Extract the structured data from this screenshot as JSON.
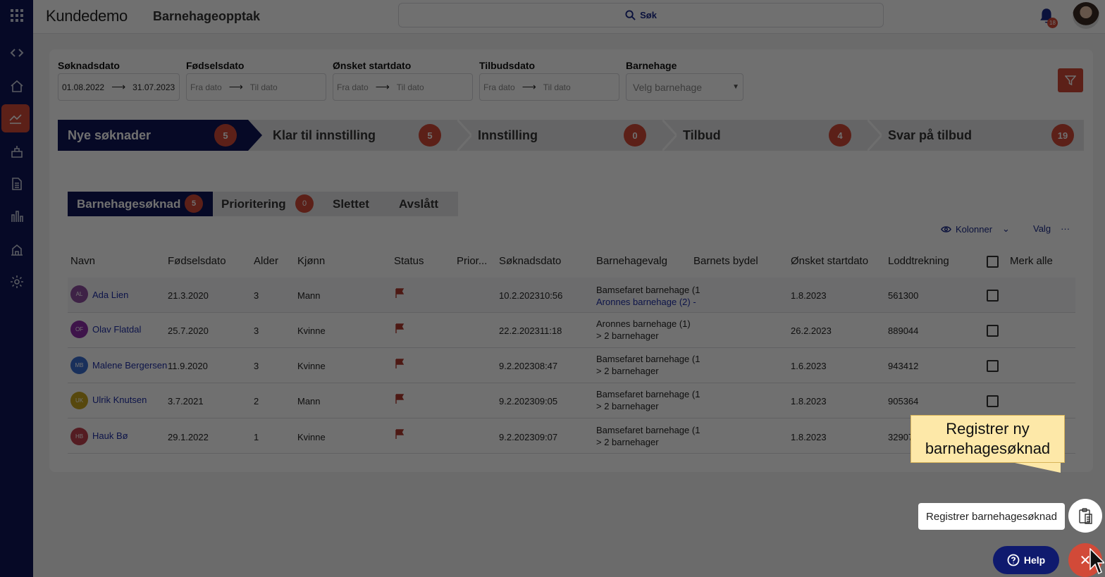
{
  "app": {
    "brand": "Kundedemo",
    "module": "Barnehageopptak"
  },
  "search": {
    "label": "Søk"
  },
  "notifications": {
    "count": "18"
  },
  "filters": [
    {
      "label": "Søknadsdato",
      "from": "01.08.2022",
      "to": "31.07.2023"
    },
    {
      "label": "Fødselsdato",
      "from": "Fra dato",
      "to": "Til dato"
    },
    {
      "label": "Ønsket startdato",
      "from": "Fra dato",
      "to": "Til dato"
    },
    {
      "label": "Tilbudsdato",
      "from": "Fra dato",
      "to": "Til dato"
    },
    {
      "label": "Barnehage",
      "placeholder": "Velg barnehage"
    }
  ],
  "steps": [
    {
      "label": "Nye søknader",
      "count": "5"
    },
    {
      "label": "Klar til innstilling",
      "count": "5"
    },
    {
      "label": "Innstilling",
      "count": "0"
    },
    {
      "label": "Tilbud",
      "count": "4"
    },
    {
      "label": "Svar på tilbud",
      "count": "19"
    }
  ],
  "subtabs": [
    {
      "label": "Barnehagesøknad",
      "count": "5"
    },
    {
      "label": "Prioritering",
      "count": "0"
    },
    {
      "label": "Slettet"
    },
    {
      "label": "Avslått"
    }
  ],
  "tools": {
    "columns": "Kolonner",
    "options": "Valg"
  },
  "columns": [
    "Navn",
    "Fødselsdato",
    "Alder",
    "Kjønn",
    "Status",
    "Prior...",
    "Søknadsdato",
    "Barnehagevalg",
    "Barnets bydel",
    "Ønsket startdato",
    "Loddtrekning",
    "Merk alle"
  ],
  "rows": [
    {
      "initials": "AL",
      "color": "#8e4fa0",
      "name": "Ada Lien",
      "dob": "21.3.2020",
      "age": "3",
      "gender": "Mann",
      "applied": "10.2.202310:56",
      "choice1": "Bamsefaret barnehage (1",
      "choice2": "Aronnes barnehage (2) -",
      "start": "1.8.2023",
      "lottery": "561300"
    },
    {
      "initials": "OF",
      "color": "#8e2fa8",
      "name": "Olav Flatdal",
      "dob": "25.7.2020",
      "age": "3",
      "gender": "Kvinne",
      "applied": "22.2.202311:18",
      "choice1": "Aronnes barnehage (1)",
      "choice2": "2 barnehager",
      "start": "26.2.2023",
      "lottery": "889044"
    },
    {
      "initials": "MB",
      "color": "#3a6fd0",
      "name": "Malene Bergersen",
      "dob": "11.9.2020",
      "age": "3",
      "gender": "Kvinne",
      "applied": "9.2.202308:47",
      "choice1": "Bamsefaret barnehage (1",
      "choice2": "2 barnehager",
      "start": "1.6.2023",
      "lottery": "943412"
    },
    {
      "initials": "UK",
      "color": "#c7a51e",
      "name": "Ulrik Knutsen",
      "dob": "3.7.2021",
      "age": "2",
      "gender": "Mann",
      "applied": "9.2.202309:05",
      "choice1": "Bamsefaret barnehage (1",
      "choice2": "2 barnehager",
      "start": "1.8.2023",
      "lottery": "905364"
    },
    {
      "initials": "HB",
      "color": "#c0404e",
      "name": "Hauk Bø",
      "dob": "29.1.2022",
      "age": "1",
      "gender": "Kvinne",
      "applied": "9.2.202309:07",
      "choice1": "Bamsefaret barnehage (1",
      "choice2": "2 barnehager",
      "start": "1.8.2023",
      "lottery": "32907"
    }
  ],
  "tooltip": {
    "text": "Registrer ny barnehagesøknad"
  },
  "register": {
    "label": "Registrer barnehagesøknad"
  },
  "help": {
    "label": "Help"
  },
  "colors": {
    "navy": "#0f1657",
    "accent": "#d24a38",
    "link": "#1f2fa6",
    "tooltip_bg": "#fde8a8"
  }
}
